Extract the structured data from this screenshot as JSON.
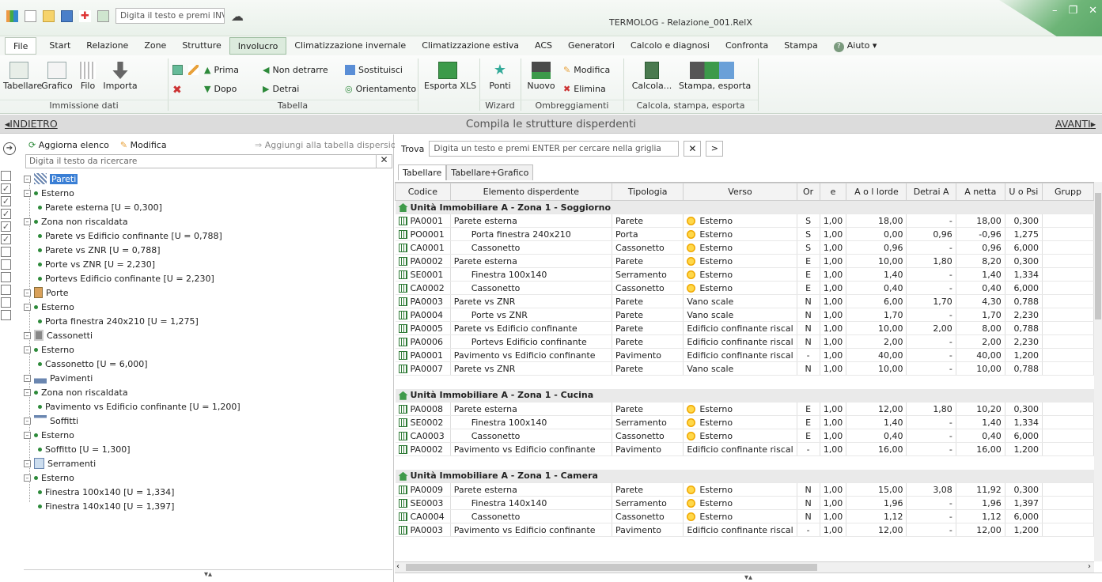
{
  "app": {
    "title": "TERMOLOG - Relazione_001.RelX",
    "quick_search_placeholder": "Digita il testo e premi INVIO"
  },
  "menu": [
    "File",
    "Start",
    "Relazione",
    "Zone",
    "Strutture",
    "Involucro",
    "Climatizzazione invernale",
    "Climatizzazione estiva",
    "ACS",
    "Generatori",
    "Calcolo e diagnosi",
    "Confronta",
    "Stampa",
    "Aiuto"
  ],
  "ribbon": {
    "tabellare": "Tabellare",
    "grafico": "Grafico",
    "filo": "Filo",
    "importa": "Importa",
    "group1": "Immissione dati",
    "prima": "Prima",
    "dopo": "Dopo",
    "non_detrarre": "Non detrarre",
    "detrai": "Detrai",
    "sostituisci": "Sostituisci",
    "orientamento": "Orientamento",
    "group2": "Tabella",
    "esporta_xls": "Esporta XLS",
    "ponti": "Ponti",
    "group3": "Wizard",
    "nuovo": "Nuovo",
    "modifica": "Modifica",
    "elimina": "Elimina",
    "group4": "Ombreggiamenti",
    "calcola": "Calcola...",
    "stampa_esporta": "Stampa, esporta",
    "group5": "Calcola, stampa, esporta"
  },
  "nav": {
    "back": "INDIETRO",
    "title": "Compila le strutture disperdenti",
    "next": "AVANTI"
  },
  "left": {
    "aggiorna": "Aggiorna elenco",
    "modifica": "Modifica",
    "aggiungi": "Aggiungi alla tabella dispersioni",
    "search_placeholder": "Digita il testo da ricercare",
    "tree": [
      "Pareti",
      "Esterno",
      "Parete esterna  [U = 0,300]",
      "Zona non riscaldata",
      "Parete vs Edificio confinante  [U = 0,788]",
      "Parete vs ZNR  [U = 0,788]",
      "Porte vs ZNR [U = 2,230]",
      "Portevs Edificio confinante  [U = 2,230]",
      "Porte",
      "Esterno",
      "Porta finestra 240x210 [U = 1,275]",
      "Cassonetti",
      "Esterno",
      "Cassonetto [U = 6,000]",
      "Pavimenti",
      "Zona non riscaldata",
      "Pavimento vs Edificio confinante  [U = 1,200]",
      "Soffitti",
      "Esterno",
      "Soffitto [U = 1,300]",
      "Serramenti",
      "Esterno",
      "Finestra 100x140 [U = 1,334]",
      "Finestra 140x140 [U = 1,397]"
    ]
  },
  "right": {
    "find_label": "Trova",
    "find_placeholder": "Digita un testo e premi ENTER per cercare nella griglia",
    "tabs": [
      "Tabellare",
      "Tabellare+Grafico"
    ],
    "columns": [
      "Codice",
      "Elemento disperdente",
      "Tipologia",
      "Verso",
      "Or",
      "e",
      "A o l lorde",
      "Detrai A",
      "A netta",
      "U o Psi",
      "Grupp"
    ],
    "groups": [
      {
        "title": "Unità Immobiliare A - Zona 1 - Soggiorno",
        "rows": [
          [
            "PA0001",
            "Parete esterna",
            "Parete",
            "Esterno",
            "S",
            "1,00",
            "18,00",
            "-",
            "18,00",
            "0,300"
          ],
          [
            "PO0001",
            "Porta finestra 240x210",
            "Porta",
            "Esterno",
            "S",
            "1,00",
            "0,00",
            "0,96",
            "-0,96",
            "1,275"
          ],
          [
            "CA0001",
            "Cassonetto",
            "Cassonetto",
            "Esterno",
            "S",
            "1,00",
            "0,96",
            "-",
            "0,96",
            "6,000"
          ],
          [
            "PA0002",
            "Parete esterna",
            "Parete",
            "Esterno",
            "E",
            "1,00",
            "10,00",
            "1,80",
            "8,20",
            "0,300"
          ],
          [
            "SE0001",
            "Finestra 100x140",
            "Serramento",
            "Esterno",
            "E",
            "1,00",
            "1,40",
            "-",
            "1,40",
            "1,334"
          ],
          [
            "CA0002",
            "Cassonetto",
            "Cassonetto",
            "Esterno",
            "E",
            "1,00",
            "0,40",
            "-",
            "0,40",
            "6,000"
          ],
          [
            "PA0003",
            "Parete vs ZNR",
            "Parete",
            "Vano scale",
            "N",
            "1,00",
            "6,00",
            "1,70",
            "4,30",
            "0,788"
          ],
          [
            "PA0004",
            "Porte vs ZNR",
            "Parete",
            "Vano scale",
            "N",
            "1,00",
            "1,70",
            "-",
            "1,70",
            "2,230"
          ],
          [
            "PA0005",
            "Parete vs Edificio confinante",
            "Parete",
            "Edificio  confinante riscal",
            "N",
            "1,00",
            "10,00",
            "2,00",
            "8,00",
            "0,788"
          ],
          [
            "PA0006",
            "Portevs Edificio confinante",
            "Parete",
            "Edificio  confinante riscal",
            "N",
            "1,00",
            "2,00",
            "-",
            "2,00",
            "2,230"
          ],
          [
            "PA0001",
            "Pavimento vs Edificio confinante",
            "Pavimento",
            "Edificio  confinante riscal",
            "-",
            "1,00",
            "40,00",
            "-",
            "40,00",
            "1,200"
          ],
          [
            "PA0007",
            "Parete vs ZNR",
            "Parete",
            "Vano scale",
            "N",
            "1,00",
            "10,00",
            "-",
            "10,00",
            "0,788"
          ]
        ]
      },
      {
        "title": "Unità Immobiliare A - Zona 1 - Cucina",
        "rows": [
          [
            "PA0008",
            "Parete esterna",
            "Parete",
            "Esterno",
            "E",
            "1,00",
            "12,00",
            "1,80",
            "10,20",
            "0,300"
          ],
          [
            "SE0002",
            "Finestra 100x140",
            "Serramento",
            "Esterno",
            "E",
            "1,00",
            "1,40",
            "-",
            "1,40",
            "1,334"
          ],
          [
            "CA0003",
            "Cassonetto",
            "Cassonetto",
            "Esterno",
            "E",
            "1,00",
            "0,40",
            "-",
            "0,40",
            "6,000"
          ],
          [
            "PA0002",
            "Pavimento vs Edificio confinante",
            "Pavimento",
            "Edificio  confinante riscal",
            "-",
            "1,00",
            "16,00",
            "-",
            "16,00",
            "1,200"
          ]
        ]
      },
      {
        "title": "Unità Immobiliare A - Zona 1 - Camera",
        "rows": [
          [
            "PA0009",
            "Parete esterna",
            "Parete",
            "Esterno",
            "N",
            "1,00",
            "15,00",
            "3,08",
            "11,92",
            "0,300"
          ],
          [
            "SE0003",
            "Finestra 140x140",
            "Serramento",
            "Esterno",
            "N",
            "1,00",
            "1,96",
            "-",
            "1,96",
            "1,397"
          ],
          [
            "CA0004",
            "Cassonetto",
            "Cassonetto",
            "Esterno",
            "N",
            "1,00",
            "1,12",
            "-",
            "1,12",
            "6,000"
          ],
          [
            "PA0003",
            "Pavimento vs Edificio confinante",
            "Pavimento",
            "Edificio  confinante riscal",
            "-",
            "1,00",
            "12,00",
            "-",
            "12,00",
            "1,200"
          ]
        ]
      }
    ]
  },
  "colors": {
    "accent": "#3e9650",
    "selection": "#3a7fd5"
  }
}
